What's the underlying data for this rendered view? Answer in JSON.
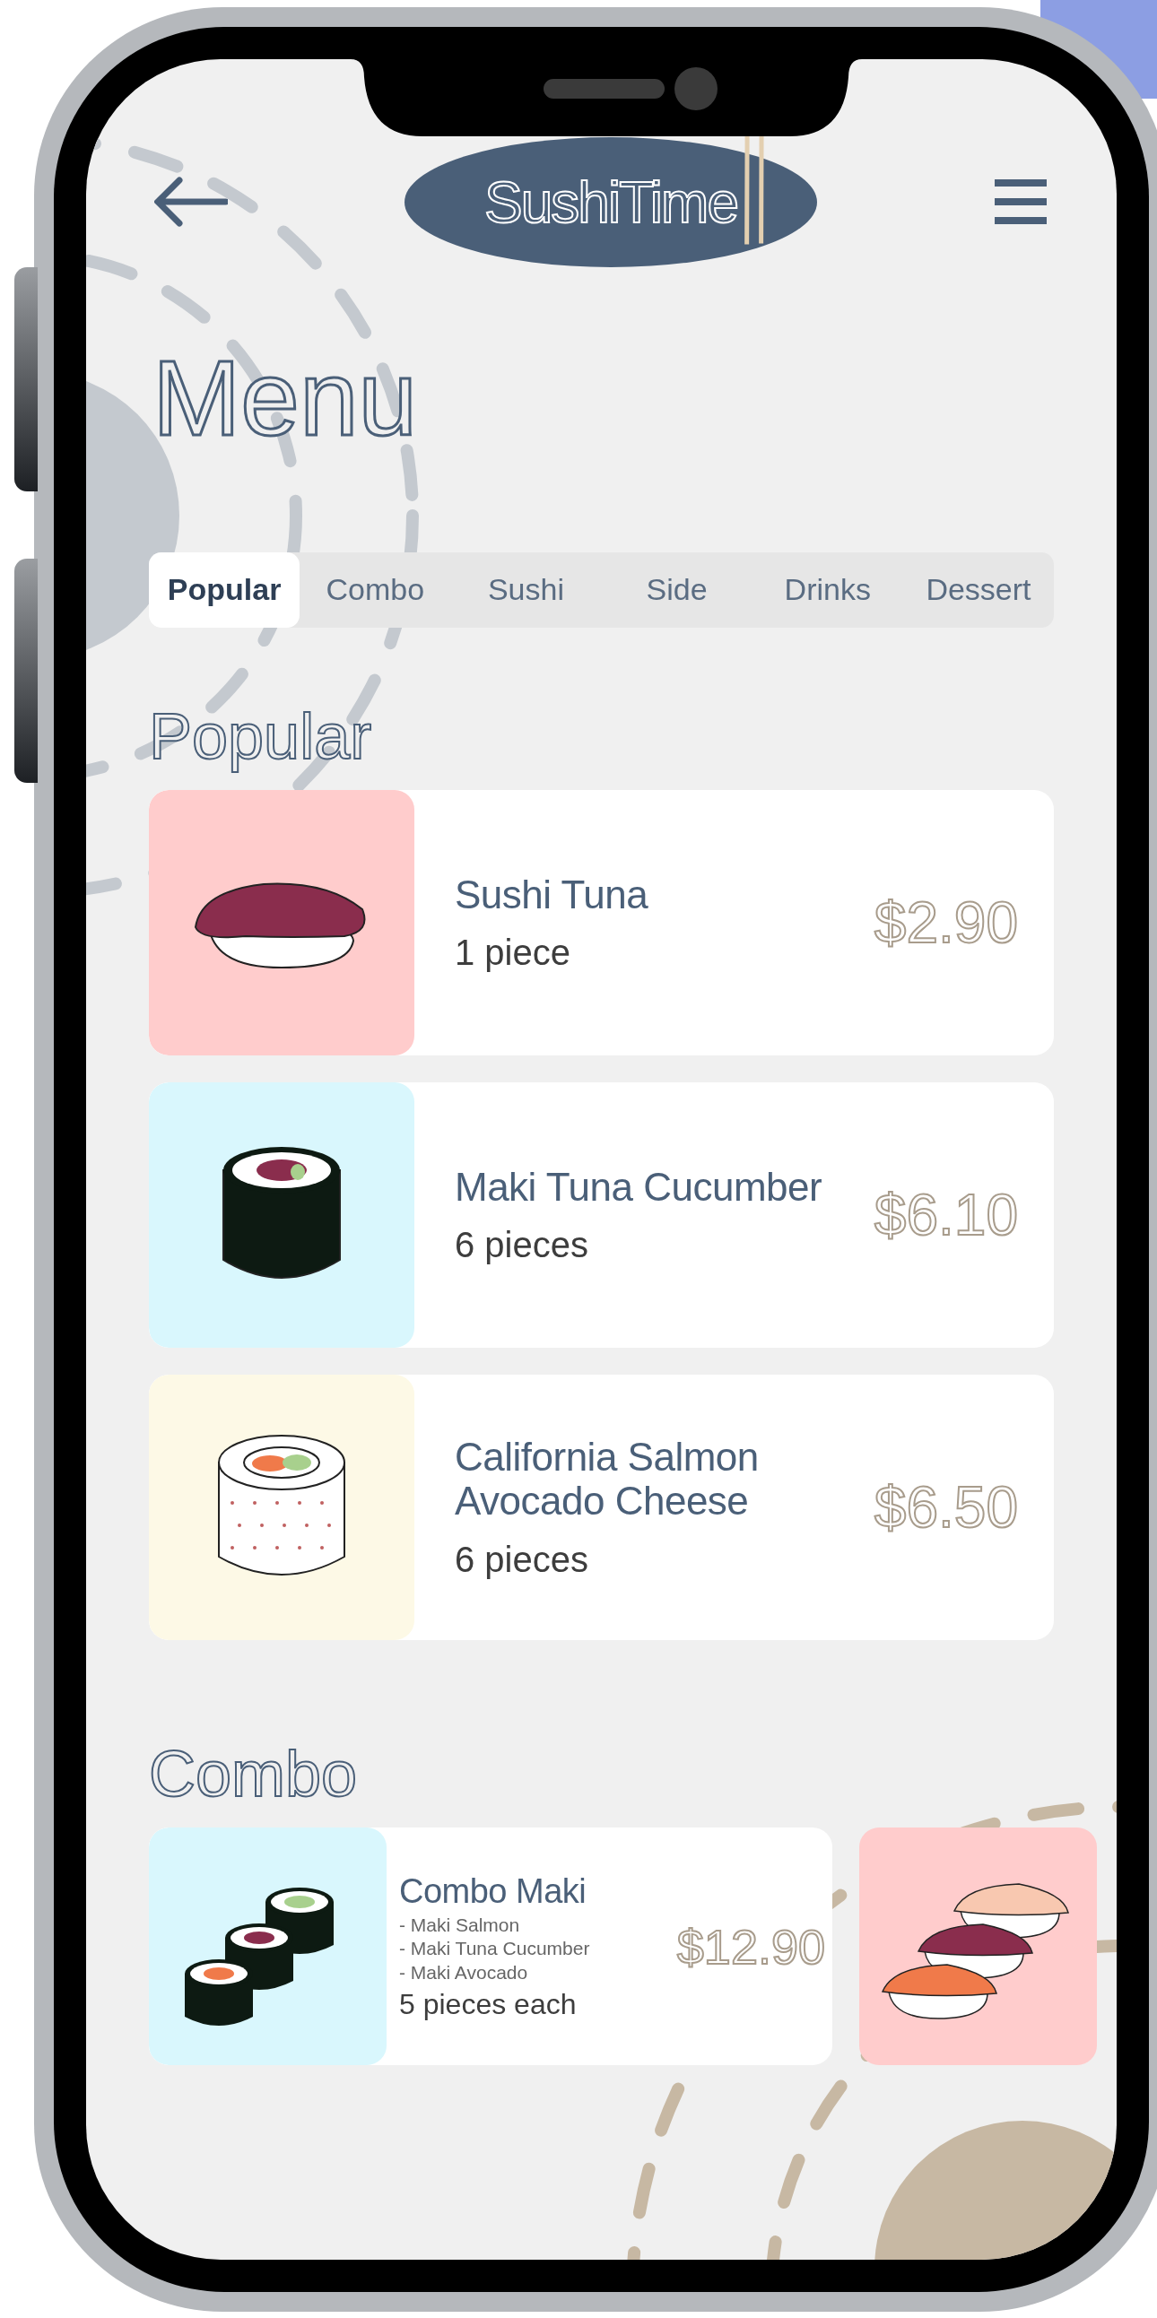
{
  "header": {
    "logo": "SushiTime"
  },
  "title": "Menu",
  "tabs": [
    {
      "label": "Popular",
      "selected": true
    },
    {
      "label": "Combo",
      "selected": false
    },
    {
      "label": "Sushi",
      "selected": false
    },
    {
      "label": "Side",
      "selected": false
    },
    {
      "label": "Drinks",
      "selected": false
    },
    {
      "label": "Dessert",
      "selected": false
    }
  ],
  "sections": [
    {
      "heading": "Popular",
      "kind": "list",
      "items": [
        {
          "name": "Sushi Tuna",
          "portion": "1 piece",
          "price": "$2.90",
          "color": "#ffcccc",
          "kind": "nigiri"
        },
        {
          "name": "Maki Tuna Cucumber",
          "portion": "6 pieces",
          "price": "$6.10",
          "color": "#d9f7fd",
          "kind": "maki"
        },
        {
          "name": "California Salmon Avocado Cheese",
          "portion": "6 pieces",
          "price": "$6.50",
          "color": "#fdf9e6",
          "kind": "california"
        }
      ]
    },
    {
      "heading": "Combo",
      "kind": "carousel",
      "items": [
        {
          "name": "Combo Maki",
          "contents": [
            "- Maki Salmon",
            "- Maki Tuna Cucumber",
            "- Maki Avocado"
          ],
          "portion": "5 pieces each",
          "price": "$12.90",
          "color": "#d9f7fd",
          "kind": "makitrio"
        },
        {
          "color": "#ffcccc",
          "kind": "nigiritrio"
        }
      ]
    }
  ]
}
